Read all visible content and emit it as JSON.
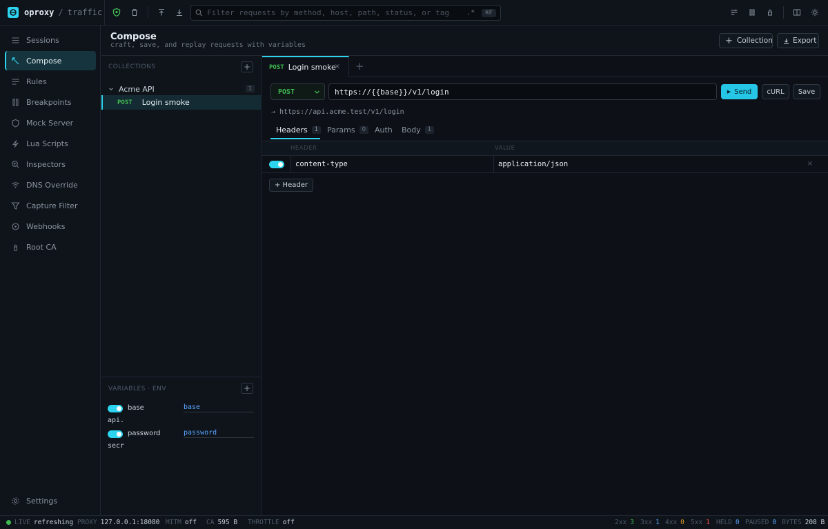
{
  "app": {
    "name": "oproxy",
    "separator": "/",
    "section": "traffic"
  },
  "search": {
    "placeholder": "Filter requests by method, host, path, status, or tag",
    "regex_label": ".*",
    "shortcut": "⌘F"
  },
  "nav": {
    "items": [
      {
        "label": "Sessions",
        "icon": "list-icon",
        "active": false
      },
      {
        "label": "Compose",
        "icon": "compose-icon",
        "active": true
      },
      {
        "label": "Rules",
        "icon": "rules-icon",
        "active": false
      },
      {
        "label": "Breakpoints",
        "icon": "breakpoints-icon",
        "active": false
      },
      {
        "label": "Mock Server",
        "icon": "shield-icon",
        "active": false
      },
      {
        "label": "Lua Scripts",
        "icon": "lua-icon",
        "active": false
      },
      {
        "label": "Inspectors",
        "icon": "inspector-icon",
        "active": false
      },
      {
        "label": "DNS Override",
        "icon": "wifi-icon",
        "active": false
      },
      {
        "label": "Capture Filter",
        "icon": "filter-icon",
        "active": false
      },
      {
        "label": "Webhooks",
        "icon": "webhook-icon",
        "active": false
      },
      {
        "label": "Root CA",
        "icon": "certificate-icon",
        "active": false
      }
    ],
    "settings": {
      "label": "Settings",
      "icon": "gear-icon"
    }
  },
  "compose": {
    "title": "Compose",
    "subtitle": "craft, save, and replay requests with variables",
    "collection_button": "Collection",
    "export_button": "Export"
  },
  "collections": {
    "heading": "COLLECTIONS",
    "items": [
      {
        "name": "Acme API",
        "count": "1",
        "requests": [
          {
            "method": "POST",
            "name": "Login smoke"
          }
        ]
      }
    ]
  },
  "variables": {
    "heading": "VARIABLES · ENV",
    "items": [
      {
        "key": "base",
        "value": "base",
        "overflow": "api.",
        "enabled": true
      },
      {
        "key": "password",
        "value": "password",
        "overflow": "secr",
        "enabled": true
      }
    ]
  },
  "editor": {
    "tab": {
      "method": "POST",
      "label": "Login smoke",
      "close": "×"
    },
    "method": "POST",
    "url": "https://{{base}}/v1/login",
    "send_label": "Send",
    "curl_label": "cURL",
    "save_label": "Save",
    "resolved_url": "→ https://api.acme.test/v1/login",
    "subtabs": [
      {
        "label": "Headers",
        "badge": "1",
        "active": true
      },
      {
        "label": "Params",
        "badge": "0",
        "active": false
      },
      {
        "label": "Auth",
        "badge": "",
        "active": false
      },
      {
        "label": "Body",
        "badge": "1",
        "active": false
      }
    ],
    "headers_table": {
      "columns": [
        "HEADER",
        "VALUE"
      ],
      "rows": [
        {
          "enabled": true,
          "key": "content-type",
          "value": "application/json"
        }
      ],
      "add_label": "+ Header"
    }
  },
  "status": {
    "live_label": "LIVE",
    "live_value": "refreshing",
    "proxy_label": "PROXY",
    "proxy_value": "127.0.0.1:18080",
    "mitm_label": "MITM",
    "mitm_value": "off",
    "ca_label": "CA",
    "ca_value": "595 B",
    "throttle_label": "THROTTLE",
    "throttle_value": "off",
    "counts": [
      {
        "label": "2xx",
        "value": "3",
        "color": "#3fb950"
      },
      {
        "label": "3xx",
        "value": "1",
        "color": "#58a6ff"
      },
      {
        "label": "4xx",
        "value": "0",
        "color": "#d29922"
      },
      {
        "label": "5xx",
        "value": "1",
        "color": "#f85149"
      },
      {
        "label": "HELD",
        "value": "0",
        "color": "#58a6ff"
      },
      {
        "label": "PAUSED",
        "value": "0",
        "color": "#58a6ff"
      },
      {
        "label": "BYTES",
        "value": "208 B",
        "color": "#c9d1d9"
      }
    ]
  },
  "colors": {
    "accent": "#2dd4ef",
    "method_post": "#3fb950",
    "background": "#0d1117",
    "panel": "#0f141b"
  }
}
